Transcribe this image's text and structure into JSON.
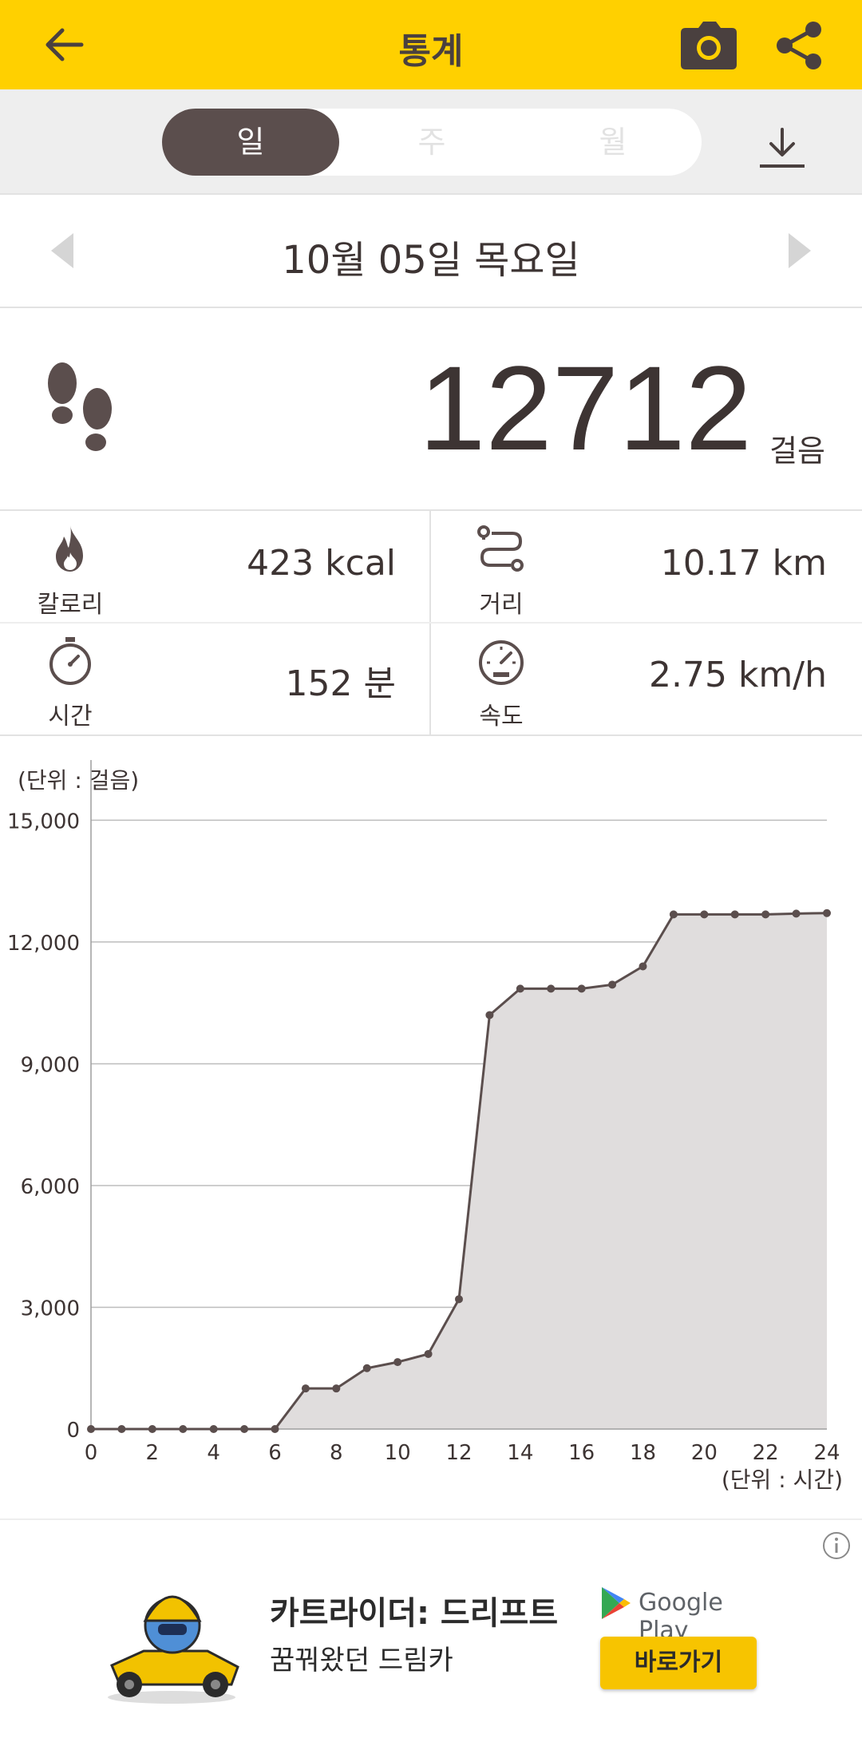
{
  "header": {
    "title": "통계",
    "icons": [
      "back-arrow-icon",
      "camera-icon",
      "share-icon"
    ]
  },
  "period_tabs": {
    "items": [
      {
        "label": "일",
        "active": true
      },
      {
        "label": "주",
        "active": false
      },
      {
        "label": "월",
        "active": false
      }
    ]
  },
  "date_nav": {
    "date": "10월 05일 목요일"
  },
  "steps": {
    "value": "12712",
    "unit": "걸음"
  },
  "stats": {
    "calories": {
      "value": "423 kcal",
      "label": "칼로리"
    },
    "distance": {
      "value": "10.17 km",
      "label": "거리"
    },
    "time": {
      "value": "152 분",
      "label": "시간"
    },
    "speed": {
      "value": "2.75 km/h",
      "label": "속도"
    }
  },
  "chart_units": {
    "y": "(단위 : 걸음)",
    "x": "(단위 : 시간)"
  },
  "chart_data": {
    "type": "area",
    "title": "",
    "xlabel": "(단위 : 시간)",
    "ylabel": "(단위 : 걸음)",
    "x": [
      0,
      1,
      2,
      3,
      4,
      5,
      6,
      7,
      8,
      9,
      10,
      11,
      12,
      13,
      14,
      15,
      16,
      17,
      18,
      19,
      20,
      21,
      22,
      23,
      24
    ],
    "values": [
      0,
      0,
      0,
      0,
      0,
      0,
      0,
      1000,
      1000,
      1500,
      1650,
      1850,
      3200,
      10200,
      10850,
      10850,
      10850,
      10950,
      11400,
      12680,
      12680,
      12680,
      12680,
      12700,
      12712
    ],
    "xlim": [
      0,
      24
    ],
    "ylim": [
      0,
      15500
    ],
    "x_ticks": [
      "0",
      "2",
      "4",
      "6",
      "8",
      "10",
      "12",
      "14",
      "16",
      "18",
      "20",
      "22",
      "24"
    ],
    "y_ticks": [
      "0",
      "3,000",
      "6,000",
      "9,000",
      "12,000",
      "15,000"
    ],
    "grid": true,
    "colors": {
      "line": "#5b4e4d",
      "fill": "#e0dddd",
      "grid": "#bdbdbd"
    }
  },
  "ad": {
    "title": "카트라이더: 드리프트",
    "subtitle": "꿈꿔왔던 드림카",
    "store": "Google Play",
    "cta": "바로가기"
  }
}
